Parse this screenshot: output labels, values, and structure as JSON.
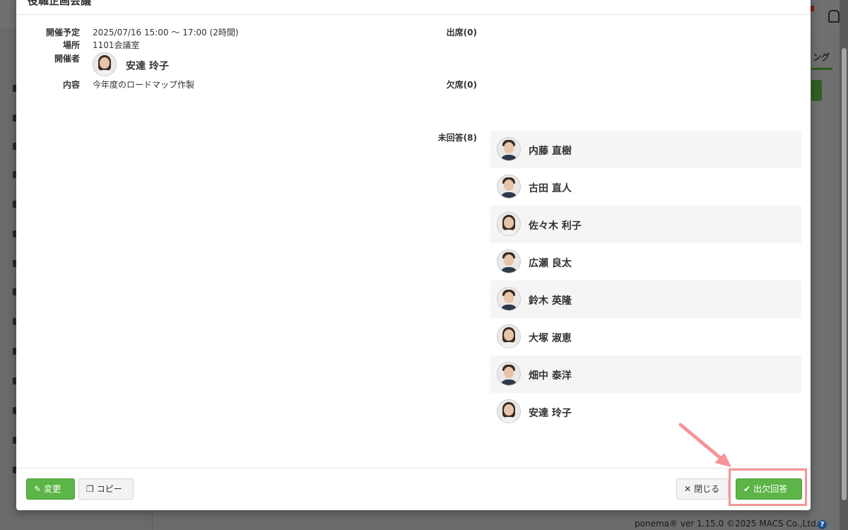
{
  "modal": {
    "title": "役職企画会議",
    "fields": {
      "schedule_label": "開催予定",
      "schedule_value": "2025/07/16 15:00 〜 17:00 (2時間)",
      "place_label": "場所",
      "place_value": "1101会議室",
      "organizer_label": "開催者",
      "organizer_name": "安達 玲子",
      "content_label": "内容",
      "content_value": "今年度のロードマップ作製"
    },
    "attendance": {
      "present_label": "出席(0)",
      "absent_label": "欠席(0)",
      "unanswered_label": "未回答(8)",
      "unanswered": [
        {
          "name": "内藤 直樹",
          "gender": "m"
        },
        {
          "name": "古田 直人",
          "gender": "m"
        },
        {
          "name": "佐々木 利子",
          "gender": "f"
        },
        {
          "name": "広瀬 良太",
          "gender": "m"
        },
        {
          "name": "鈴木 英隆",
          "gender": "m"
        },
        {
          "name": "大塚 淑恵",
          "gender": "f"
        },
        {
          "name": "畑中 泰洋",
          "gender": "m"
        },
        {
          "name": "安達 玲子",
          "gender": "f"
        }
      ]
    },
    "buttons": {
      "edit": "変更",
      "copy": "コピー",
      "close": "閉じる",
      "respond": "出欠回答"
    }
  },
  "background": {
    "tab_label": "ング",
    "footer": "ponema® ver 1.15.0 ©2025 MACS Co.,Ltd.",
    "help": "?"
  },
  "colors": {
    "accent_green": "#5cb546",
    "highlight": "#f5959a"
  }
}
